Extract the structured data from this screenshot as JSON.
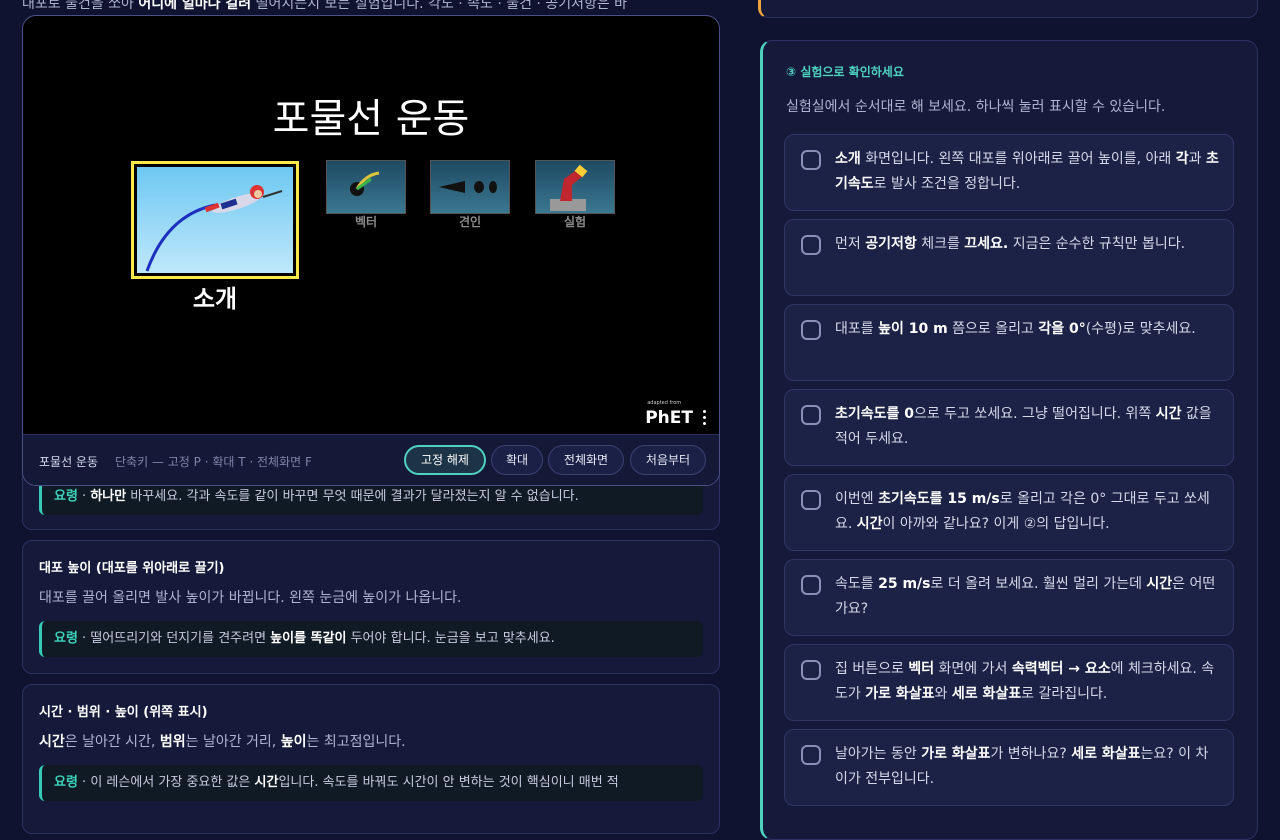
{
  "intro": {
    "part1": "대포로 물건을 쏘아 ",
    "bold1": "어디에 얼마나 걸려",
    "part2": " 떨어지는지 보는 실험입니다. 각도 · 속도 · 물건 · 공기저항은 바"
  },
  "cards": {
    "card0": {
      "tip_label": "요령",
      "tip_sep": " · ",
      "tip_bold": "하나만",
      "tip_rest": " 바꾸세요. 각과 속도를 같이 바꾸면 무엇 때문에 결과가 달라졌는지 알 수 없습니다."
    },
    "card1": {
      "title": "대포 높이 (대포를 위아래로 끌기)",
      "desc": "대포를 끌어 올리면 발사 높이가 바뀝니다. 왼쪽 눈금에 높이가 나옵니다.",
      "tip_label": "요령",
      "tip_sep": " · ",
      "tip_a": "떨어뜨리기와 던지기를 견주려면 ",
      "tip_bold": "높이를 똑같이",
      "tip_b": " 두어야 합니다. 눈금을 보고 맞추세요."
    },
    "card2": {
      "title": "시간 · 범위 · 높이 (위쪽 표시)",
      "desc_b1": "시간",
      "desc_a": "은 날아간 시간, ",
      "desc_b2": "범위",
      "desc_c": "는 날아간 거리, ",
      "desc_b3": "높이",
      "desc_d": "는 최고점입니다.",
      "tip_label": "요령",
      "tip_sep": " · ",
      "tip_a": "이 레슨에서 가장 중요한 값은 ",
      "tip_bold": "시간",
      "tip_b": "입니다. 속도를 바꿔도 시간이 안 변하는 것이 핵심이니 매번 적"
    }
  },
  "sim": {
    "title": "포물선 운동",
    "screens": {
      "intro": "소개",
      "vectors": "벡터",
      "drag": "견인",
      "lab": "실험"
    },
    "phet_small": "adapted from",
    "phet": "PhET",
    "bar": {
      "name": "포물선 운동",
      "shortcuts": "단축키 — 고정 P · 확대 T · 전체화면 F",
      "unpin": "고정 해제",
      "zoom": "확대",
      "fullscreen": "전체화면",
      "restart": "처음부터"
    }
  },
  "panel": {
    "title": "③ 실험으로 확인하세요",
    "desc": "실험실에서 순서대로 해 보세요. 하나씩 눌러 표시할 수 있습니다."
  },
  "steps": {
    "s1": {
      "b1": "소개",
      "t1": " 화면입니다. 왼쪽 대포를 위아래로 끌어 높이를, 아래 ",
      "b2": "각",
      "t2": "과 ",
      "b3": "초기속도",
      "t3": "로 발사 조건을 정합니다."
    },
    "s2": {
      "t1": "먼저 ",
      "b1": "공기저항",
      "t2": " 체크를 ",
      "b2": "끄세요.",
      "t3": " 지금은 순수한 규칙만 봅니다."
    },
    "s3": {
      "t1": "대포를 ",
      "b1": "높이 10 m",
      "t2": " 쯤으로 올리고 ",
      "b2": "각을 0°",
      "t3": "(수평)로 맞추세요."
    },
    "s4": {
      "b1": "초기속도를 0",
      "t1": "으로 두고 쏘세요. 그냥 떨어집니다. 위쪽 ",
      "b2": "시간",
      "t2": " 값을 적어 두세요."
    },
    "s5": {
      "t1": "이번엔 ",
      "b1": "초기속도를 15 m/s",
      "t2": "로 올리고 각은 0° 그대로 두고 쏘세요. ",
      "b2": "시간",
      "t3": "이 아까와 같나요? 이게 ②의 답입니다."
    },
    "s6": {
      "t1": "속도를 ",
      "b1": "25 m/s",
      "t2": "로 더 올려 보세요. 훨씬 멀리 가는데 ",
      "b2": "시간",
      "t3": "은 어떤가요?"
    },
    "s7": {
      "t1": "집 버튼으로 ",
      "b1": "벡터",
      "t2": " 화면에 가서 ",
      "b2": "속력벡터 → 요소",
      "t3": "에 체크하세요. 속도가 ",
      "b3": "가로 화살표",
      "t4": "와 ",
      "b4": "세로 화살표",
      "t5": "로 갈라집니다."
    },
    "s8": {
      "t1": "날아가는 동안 ",
      "b1": "가로 화살표",
      "t2": "가 변하나요? ",
      "b2": "세로 화살표",
      "t3": "는요? 이 차이가 전부입니다."
    }
  }
}
